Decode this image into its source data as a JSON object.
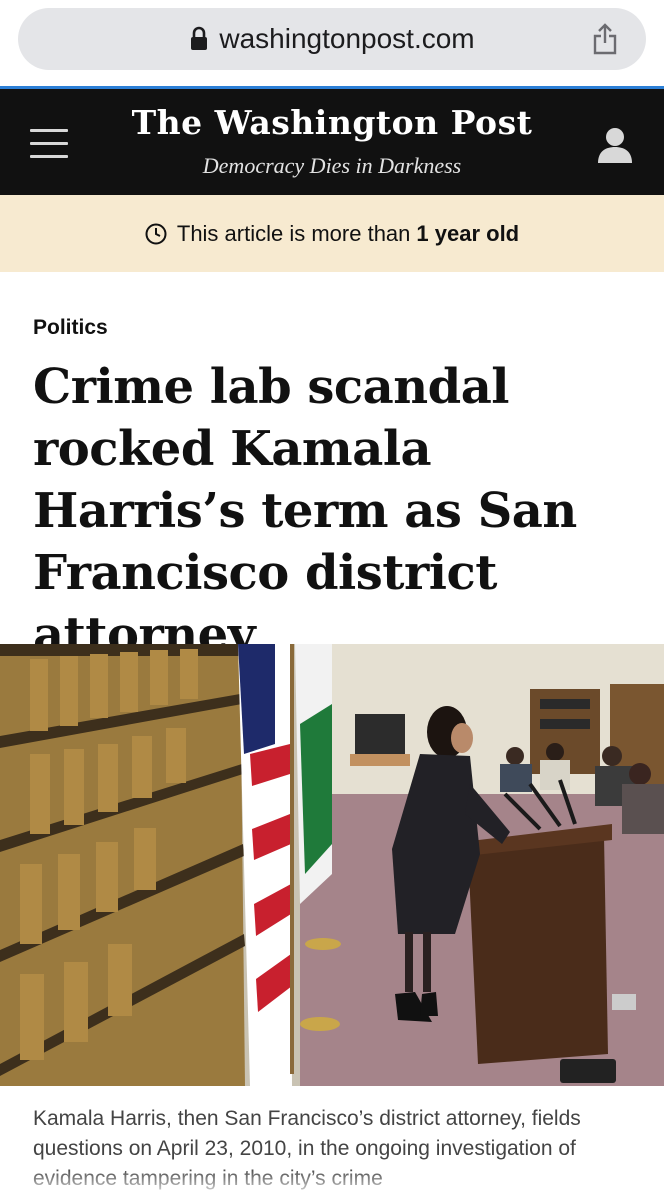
{
  "browser": {
    "url": "washingtonpost.com",
    "lock_icon": "lock-icon",
    "share_icon": "share-icon"
  },
  "masthead": {
    "logo": "The Washington Post",
    "tagline": "Democracy Dies in Darkness",
    "menu_icon": "hamburger-menu-icon",
    "account_icon": "user-account-icon"
  },
  "age_banner": {
    "text_prefix": "This article is more than",
    "text_bold": "1 year old",
    "icon": "clock-icon"
  },
  "article": {
    "kicker": "Politics",
    "headline": "Crime lab scandal rocked Kamala Harris’s term as San Francisco district attorney",
    "photo_alt": "Kamala Harris speaking at a podium next to flags in a room lined with law books",
    "caption": "Kamala Harris, then San Francisco’s district attorney, fields questions on April 23, 2010, in the ongoing investigation of evidence tampering in the city’s crime"
  },
  "colors": {
    "masthead_bg": "#111111",
    "masthead_accent": "#2b7fd6",
    "banner_bg": "#f7ead0",
    "urlbar_bg": "#e4e5e8"
  }
}
